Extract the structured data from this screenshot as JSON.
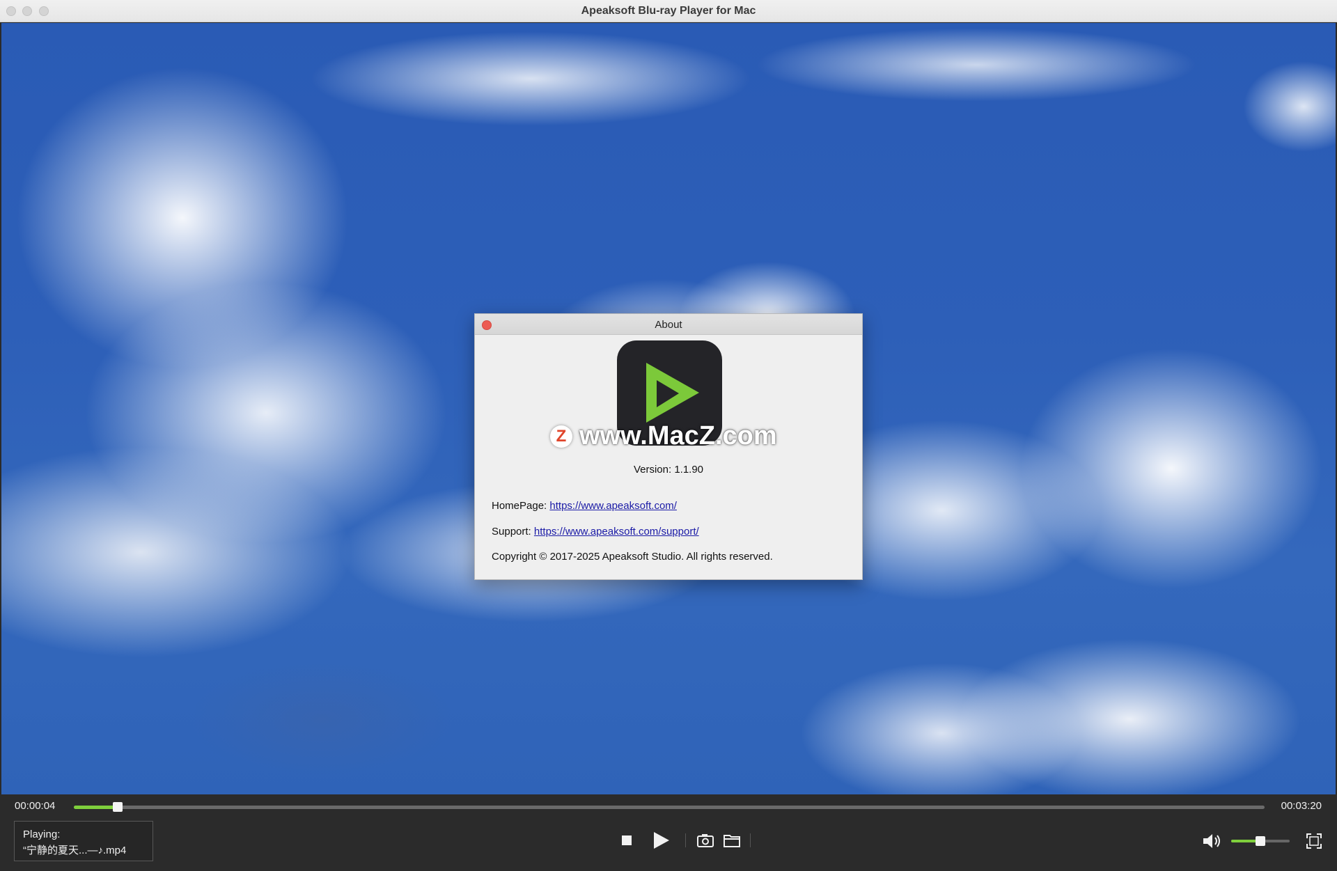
{
  "window": {
    "title": "Apeaksoft Blu-ray Player for Mac"
  },
  "about": {
    "title": "About",
    "watermark_badge": "Z",
    "watermark_text": "www.MacZ.com",
    "version": "Version: 1.1.90",
    "homepage_label": "HomePage:",
    "homepage_url": "https://www.apeaksoft.com/",
    "support_label": "Support:",
    "support_url": "https://www.apeaksoft.com/support/",
    "copyright": "Copyright © 2017-2025 Apeaksoft Studio. All rights reserved."
  },
  "player": {
    "current_time": "00:00:04",
    "total_time": "00:03:20",
    "progress_fraction": 0.02,
    "volume_fraction": 0.5,
    "now_playing_label": "Playing:",
    "now_playing_file": "“宁静的夏天...—♪.mp4",
    "accent_color": "#7fcf3c"
  },
  "icons": [
    "stop-icon",
    "play-icon",
    "snapshot-camera-icon",
    "open-folder-icon",
    "volume-icon",
    "fullscreen-icon",
    "app-play-logo-icon",
    "close-icon"
  ]
}
